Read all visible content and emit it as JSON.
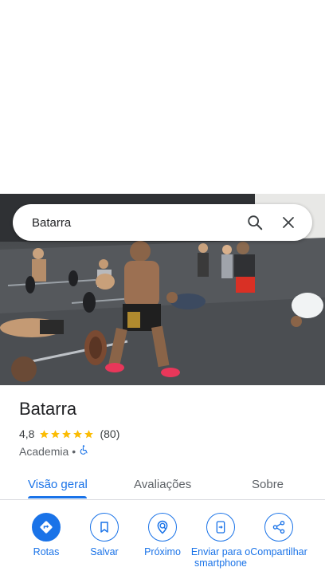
{
  "search": {
    "query": "Batarra"
  },
  "place": {
    "name": "Batarra",
    "rating": "4,8",
    "rating_value": 4.8,
    "review_count": "(80)",
    "category": "Academia",
    "separator": "•",
    "accessibility_icon": "wheelchair-icon"
  },
  "tabs": [
    {
      "label": "Visão geral",
      "active": true
    },
    {
      "label": "Avaliações",
      "active": false
    },
    {
      "label": "Sobre",
      "active": false
    }
  ],
  "actions": [
    {
      "label": "Rotas",
      "icon": "directions-icon"
    },
    {
      "label": "Salvar",
      "icon": "bookmark-icon"
    },
    {
      "label": "Próximo",
      "icon": "nearby-icon"
    },
    {
      "label": "Enviar para o smartphone",
      "icon": "send-to-phone-icon"
    },
    {
      "label": "Compartilhar",
      "icon": "share-icon"
    }
  ],
  "colors": {
    "accent": "#1a73e8",
    "star": "#fbbc04",
    "text_primary": "#202124",
    "text_secondary": "#5f6368"
  }
}
